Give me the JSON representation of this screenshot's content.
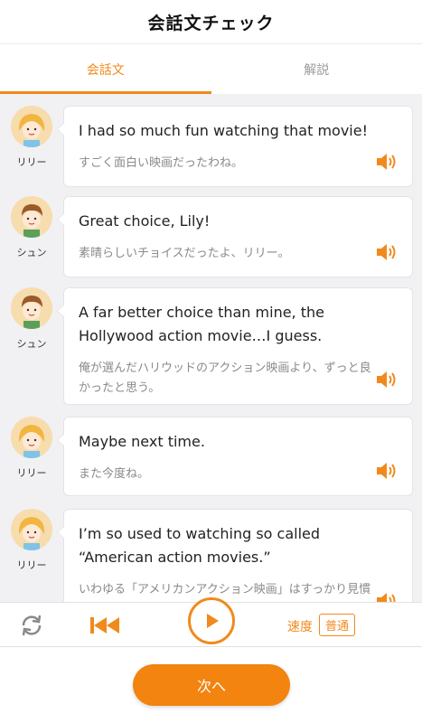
{
  "header": {
    "title": "会話文チェック"
  },
  "tabs": [
    {
      "label": "会話文",
      "active": true
    },
    {
      "label": "解説",
      "active": false
    }
  ],
  "messages": [
    {
      "speaker": "リリー",
      "avatar": "lily",
      "en": "I had so much fun watching that movie!",
      "ja": "すごく面白い映画だったわね。"
    },
    {
      "speaker": "シュン",
      "avatar": "shun",
      "en": "Great choice, Lily!",
      "ja": "素晴らしいチョイスだったよ、リリー。"
    },
    {
      "speaker": "シュン",
      "avatar": "shun",
      "en": "A far better choice than mine, the Hollywood action movie…I guess.",
      "ja": "俺が選んだハリウッドのアクション映画より、ずっと良かったと思う。"
    },
    {
      "speaker": "リリー",
      "avatar": "lily",
      "en": "Maybe next time.",
      "ja": "また今度ね。"
    },
    {
      "speaker": "リリー",
      "avatar": "lily",
      "en": "I’m so used to watching so called “American action movies.”",
      "ja": "いわゆる「アメリカンアクション映画」はすっかり見慣れてる。"
    }
  ],
  "controls": {
    "speed_label": "速度",
    "speed_value": "普通"
  },
  "footer": {
    "next_label": "次へ"
  },
  "colors": {
    "accent": "#f08a1c",
    "background": "#f1f1f3"
  }
}
